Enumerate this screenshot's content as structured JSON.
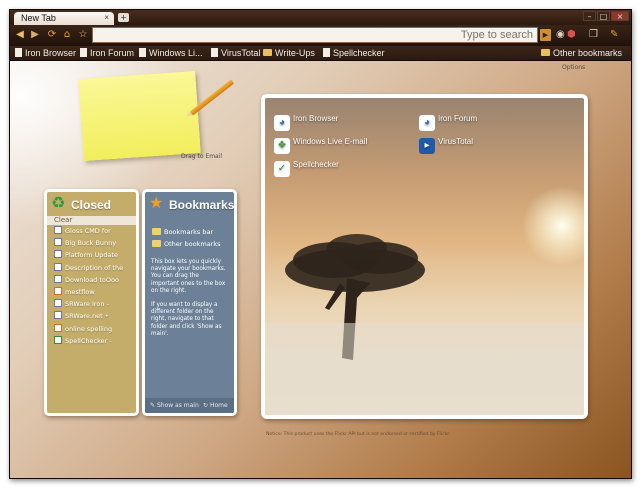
{
  "window": {
    "tab_title": "New Tab",
    "tab_close": "×",
    "new_tab": "+",
    "controls": {
      "minimize": "–",
      "maximize": "□",
      "close": "×"
    }
  },
  "toolbar": {
    "back": "◀",
    "forward": "▶",
    "reload": "⟳",
    "home": "⌂",
    "star": "☆",
    "search_placeholder": "Type to search",
    "go": "▶",
    "extension_icons": [
      "◉",
      "⬢",
      "❐",
      "✎"
    ]
  },
  "bookmarks_bar": {
    "items": [
      "Iron Browser",
      "Iron Forum",
      "Windows Li...",
      "VirusTotal",
      "Write-Ups",
      "Spellchecker"
    ],
    "other": "Other bookmarks"
  },
  "page": {
    "options_link": "Options",
    "sticky_note": "Drag to Email",
    "closed": {
      "title": "Closed",
      "clear": "Clear",
      "items": [
        "Gloss CMD for",
        "Big Buck Bunny",
        "Platform Update",
        "Description of the",
        "Download toOoo",
        "mestflow",
        "SRWare Iron -",
        "SRWare.net •",
        "online spelling",
        "SpellChecker -"
      ]
    },
    "bookmarks": {
      "title": "Bookmarks",
      "items": [
        "Bookmarks bar",
        "Other bookmarks"
      ],
      "description_1": "This box lets you quickly navigate your bookmarks. You can drag the important ones to the box on the right.",
      "description_2": "If you want to display a different folder on the right, navigate to that folder and click 'Show as main'.",
      "show_as_main": "Show as main",
      "home": "Home"
    },
    "main": {
      "tiles": [
        "Iron Browser",
        "Iron Forum",
        "Windows Live E-mail",
        "VirusTotal",
        "Spellchecker"
      ]
    },
    "footnote": "Notice: This product uses the Flickr API but is not endorsed or certified by Flickr."
  },
  "colors": {
    "chrome_dark": "#2a1a12",
    "sticky_yellow": "#f5f16a",
    "closed_panel": "#c4ac6a",
    "bookmarks_panel": "#6c8197"
  }
}
